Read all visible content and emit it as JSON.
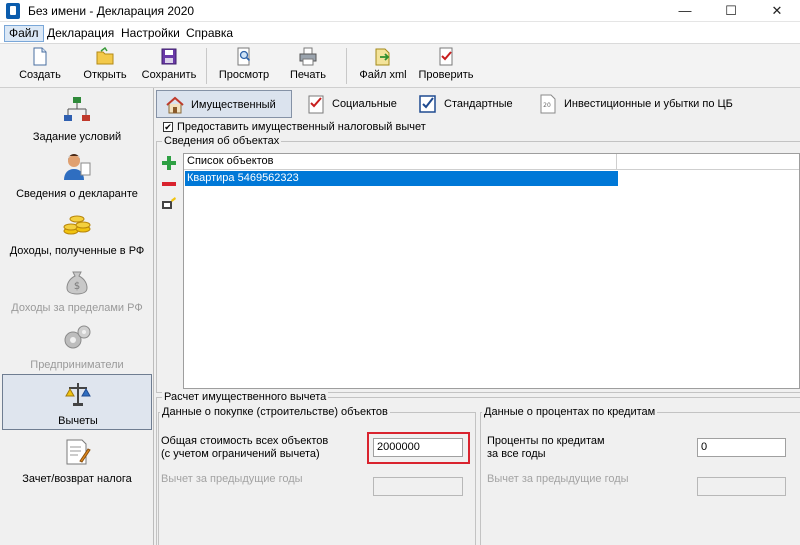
{
  "window": {
    "title": "Без имени - Декларация 2020",
    "min": "—",
    "max": "☐",
    "close": "✕"
  },
  "menu": [
    "Файл",
    "Декларация",
    "Настройки",
    "Справка"
  ],
  "toolbar": [
    "Создать",
    "Открыть",
    "Сохранить",
    "Просмотр",
    "Печать",
    "Файл xml",
    "Проверить"
  ],
  "sidebar": [
    {
      "label": "Задание условий",
      "icon": "tree-icon"
    },
    {
      "label": "Сведения о декларанте",
      "icon": "person-icon"
    },
    {
      "label": "Доходы, полученные в РФ",
      "icon": "coins-icon"
    },
    {
      "label": "Доходы за пределами РФ",
      "icon": "money-bag-icon"
    },
    {
      "label": "Предприниматели",
      "icon": "gears-icon"
    },
    {
      "label": "Вычеты",
      "icon": "scales-icon"
    },
    {
      "label": "Зачет/возврат налога",
      "icon": "document-pen-icon"
    }
  ],
  "tabs": [
    "Имущественный",
    "Социальные",
    "Стандартные",
    "Инвестиционные и убытки по ЦБ"
  ],
  "checkbox": {
    "label": "Предоставить имущественный налоговый вычет",
    "checked": "✔"
  },
  "objects": {
    "group_title": "Сведения об объектах",
    "column": "Список объектов",
    "rows": [
      "Квартира 5469562323"
    ]
  },
  "deduction": {
    "group_title": "Расчет имущественного вычета",
    "purchase": {
      "title": "Данные о покупке (строительстве) объектов",
      "total_label_1": "Общая стоимость всех объектов",
      "total_label_2": "(с учетом ограничений вычета)",
      "total_value": "2000000",
      "prev_label": "Вычет за предыдущие годы",
      "prev_value": ""
    },
    "interest": {
      "title": "Данные о процентах по кредитам",
      "label_1": "Проценты по кредитам",
      "label_2": "за все годы",
      "value": "0",
      "prev_label": "Вычет за предыдущие годы",
      "prev_value": ""
    }
  },
  "highlight_color": "#d9232e"
}
